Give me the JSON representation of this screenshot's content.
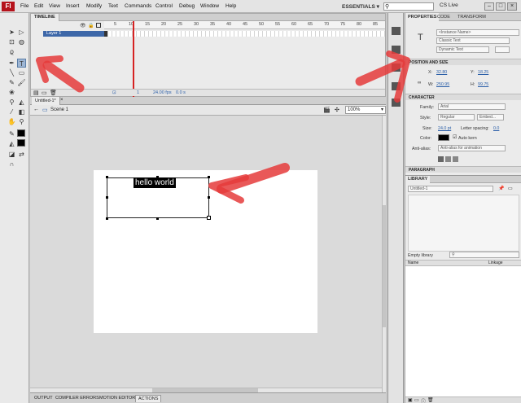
{
  "app": {
    "logo": "Fl"
  },
  "menubar": {
    "items": [
      "File",
      "Edit",
      "View",
      "Insert",
      "Modify",
      "Text",
      "Commands",
      "Control",
      "Debug",
      "Window",
      "Help"
    ],
    "workspace": "ESSENTIALS ▾",
    "cs_live": "CS Live"
  },
  "timeline": {
    "tab": "TIMELINE",
    "layer_name": "Layer 1",
    "ruler_ticks": [
      "5",
      "10",
      "15",
      "20",
      "25",
      "30",
      "35",
      "40",
      "45",
      "50",
      "55",
      "60",
      "65",
      "70",
      "75",
      "80",
      "85"
    ],
    "frame": "1",
    "fps": "24.00 fps",
    "time": "0.0 s"
  },
  "document": {
    "tab": "Untitled-1*",
    "scene": "Scene 1",
    "zoom": "100%"
  },
  "stage": {
    "text": "hello world"
  },
  "bottom_tabs": [
    "OUTPUT",
    "COMPILER ERRORS",
    "MOTION EDITOR",
    "ACTIONS"
  ],
  "properties": {
    "tabs": [
      "PROPERTIES",
      "CODE",
      "TRANSFORM"
    ],
    "instance_name": "<Instance Name>",
    "text_engine": "Classic Text",
    "text_type": "Dynamic Text",
    "sections": {
      "position": "POSITION AND SIZE",
      "character": "CHARACTER",
      "paragraph": "PARAGRAPH"
    },
    "x_label": "X:",
    "x_value": "32.80",
    "y_label": "Y:",
    "y_value": "18.25",
    "w_label": "W:",
    "w_value": "250.95",
    "h_label": "H:",
    "h_value": "99.75",
    "family_label": "Family:",
    "family_value": "Arial",
    "style_label": "Style:",
    "style_value": "Regular",
    "embed_label": "Embed...",
    "size_label": "Size:",
    "size_value": "24.0 pt",
    "spacing_label": "Letter spacing:",
    "spacing_value": "0.0",
    "color_label": "Color:",
    "autokern_label": "Auto kern",
    "antialias_label": "Anti-alias:",
    "antialias_value": "Anti-alias for animation"
  },
  "library": {
    "tab": "LIBRARY",
    "document": "Untitled-1",
    "empty_text": "Empty library",
    "col_name": "Name",
    "col_linkage": "Linkage"
  },
  "colors": {
    "annotation_arrow": "#e53b3b",
    "selection": "#3d67a8",
    "text_bg": "#000000"
  }
}
